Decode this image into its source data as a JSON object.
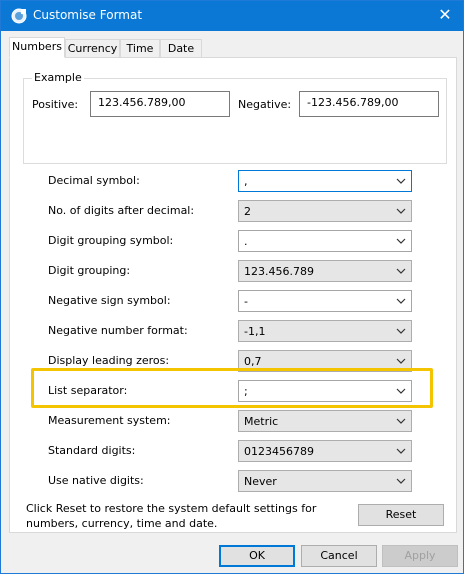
{
  "window": {
    "title": "Customise Format",
    "close_glyph": "✕"
  },
  "tabs": [
    {
      "label": "Numbers",
      "active": true
    },
    {
      "label": "Currency",
      "active": false
    },
    {
      "label": "Time",
      "active": false
    },
    {
      "label": "Date",
      "active": false
    }
  ],
  "example": {
    "legend": "Example",
    "positive_label": "Positive:",
    "positive_value": "123.456.789,00",
    "negative_label": "Negative:",
    "negative_value": "-123.456.789,00"
  },
  "settings": [
    {
      "label": "Decimal symbol:",
      "value": ",",
      "style": "focused"
    },
    {
      "label": "No. of digits after decimal:",
      "value": "2",
      "style": "grey"
    },
    {
      "label": "Digit grouping symbol:",
      "value": ".",
      "style": "white"
    },
    {
      "label": "Digit grouping:",
      "value": "123.456.789",
      "style": "grey"
    },
    {
      "label": "Negative sign symbol:",
      "value": "-",
      "style": "white"
    },
    {
      "label": "Negative number format:",
      "value": "-1,1",
      "style": "grey"
    },
    {
      "label": "Display leading zeros:",
      "value": "0,7",
      "style": "grey"
    },
    {
      "label": "List separator:",
      "value": ";",
      "style": "white"
    },
    {
      "label": "Measurement system:",
      "value": "Metric",
      "style": "grey"
    },
    {
      "label": "Standard digits:",
      "value": "0123456789",
      "style": "grey"
    },
    {
      "label": "Use native digits:",
      "value": "Never",
      "style": "grey"
    }
  ],
  "reset": {
    "text": "Click Reset to restore the system default settings for numbers, currency, time and date.",
    "button": "Reset"
  },
  "buttons": {
    "ok": "OK",
    "cancel": "Cancel",
    "apply": "Apply"
  },
  "colors": {
    "titlebar": "#0a78d4",
    "highlight": "#f5c400",
    "focus": "#0078d7"
  }
}
